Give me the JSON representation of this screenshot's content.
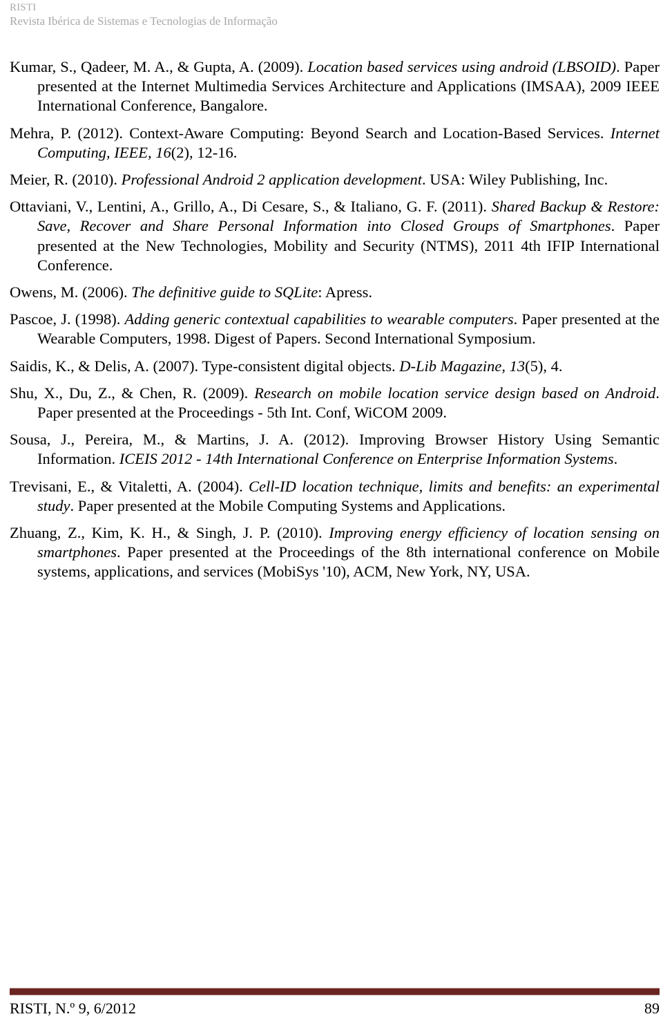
{
  "header": {
    "journal_acronym": "RISTI",
    "journal_name": "Revista Ibérica de Sistemas e Tecnologias de Informação",
    "color": "#a9a9a9"
  },
  "footer": {
    "citation": "RISTI, N.º 9, 6/2012",
    "page_number": "89",
    "rule_color": "#6b2420"
  },
  "references": [
    {
      "id": "ref-kumar-2009",
      "parts": [
        {
          "text": "Kumar, S., Qadeer, M. A., & Gupta, A. (2009). ",
          "style": "roman"
        },
        {
          "text": "Location based services using android (LBSOID)",
          "style": "italic"
        },
        {
          "text": ". Paper presented at the Internet Multimedia Services Architecture and Applications (IMSAA), 2009 IEEE International Conference, Bangalore.",
          "style": "roman"
        }
      ]
    },
    {
      "id": "ref-mehra-2012",
      "parts": [
        {
          "text": "Mehra, P. (2012). Context-Aware Computing: Beyond Search and Location-Based Services. ",
          "style": "roman"
        },
        {
          "text": "Internet Computing, IEEE, 16",
          "style": "italic"
        },
        {
          "text": "(2), 12-16.",
          "style": "roman"
        }
      ]
    },
    {
      "id": "ref-meier-2010",
      "parts": [
        {
          "text": "Meier, R. (2010). ",
          "style": "roman"
        },
        {
          "text": "Professional Android 2 application development",
          "style": "italic"
        },
        {
          "text": ". USA: Wiley Publishing, Inc.",
          "style": "roman"
        }
      ]
    },
    {
      "id": "ref-ottaviani-2011",
      "parts": [
        {
          "text": "Ottaviani, V., Lentini, A., Grillo, A., Di Cesare, S., & Italiano, G. F. (2011). ",
          "style": "roman"
        },
        {
          "text": "Shared Backup & Restore: Save, Recover and Share Personal Information into Closed Groups of Smartphones",
          "style": "italic"
        },
        {
          "text": ". Paper presented at the New Technologies, Mobility and Security (NTMS), 2011 4th IFIP International Conference.",
          "style": "roman"
        }
      ]
    },
    {
      "id": "ref-owens-2006",
      "parts": [
        {
          "text": "Owens, M. (2006). ",
          "style": "roman"
        },
        {
          "text": "The definitive guide to SQLite",
          "style": "italic"
        },
        {
          "text": ": Apress.",
          "style": "roman"
        }
      ]
    },
    {
      "id": "ref-pascoe-1998",
      "parts": [
        {
          "text": "Pascoe, J. (1998). ",
          "style": "roman"
        },
        {
          "text": "Adding generic contextual capabilities to wearable computers",
          "style": "italic"
        },
        {
          "text": ". Paper presented at the Wearable Computers, 1998. Digest of Papers. Second International Symposium.",
          "style": "roman"
        }
      ]
    },
    {
      "id": "ref-saidis-2007",
      "parts": [
        {
          "text": "Saidis, K., & Delis, A. (2007). Type-consistent digital objects. ",
          "style": "roman"
        },
        {
          "text": "D-Lib Magazine, 13",
          "style": "italic"
        },
        {
          "text": "(5), 4.",
          "style": "roman"
        }
      ]
    },
    {
      "id": "ref-shu-2009",
      "parts": [
        {
          "text": "Shu, X., Du, Z., & Chen, R. (2009). ",
          "style": "roman"
        },
        {
          "text": "Research on mobile location service design based on Android",
          "style": "italic"
        },
        {
          "text": ". Paper presented at the Proceedings - 5th Int. Conf, WiCOM 2009.",
          "style": "roman"
        }
      ]
    },
    {
      "id": "ref-sousa-2012",
      "parts": [
        {
          "text": "Sousa, J., Pereira, M., & Martins, J. A. (2012). Improving Browser History Using Semantic Information. ",
          "style": "roman"
        },
        {
          "text": "ICEIS 2012 - 14th International Conference on Enterprise Information Systems",
          "style": "italic"
        },
        {
          "text": ".",
          "style": "roman"
        }
      ]
    },
    {
      "id": "ref-trevisani-2004",
      "parts": [
        {
          "text": "Trevisani, E., & Vitaletti, A. (2004). ",
          "style": "roman"
        },
        {
          "text": "Cell-ID location technique, limits and benefits: an experimental study",
          "style": "italic"
        },
        {
          "text": ". Paper presented at the Mobile Computing Systems and Applications.",
          "style": "roman"
        }
      ]
    },
    {
      "id": "ref-zhuang-2010",
      "parts": [
        {
          "text": "Zhuang, Z., Kim, K. H., & Singh, J. P. (2010). ",
          "style": "roman"
        },
        {
          "text": "Improving energy efficiency of location sensing on smartphones",
          "style": "italic"
        },
        {
          "text": ". Paper presented at the Proceedings of the 8th international conference on Mobile systems, applications, and services (MobiSys '10), ACM, New York, NY, USA.",
          "style": "roman"
        }
      ]
    }
  ]
}
